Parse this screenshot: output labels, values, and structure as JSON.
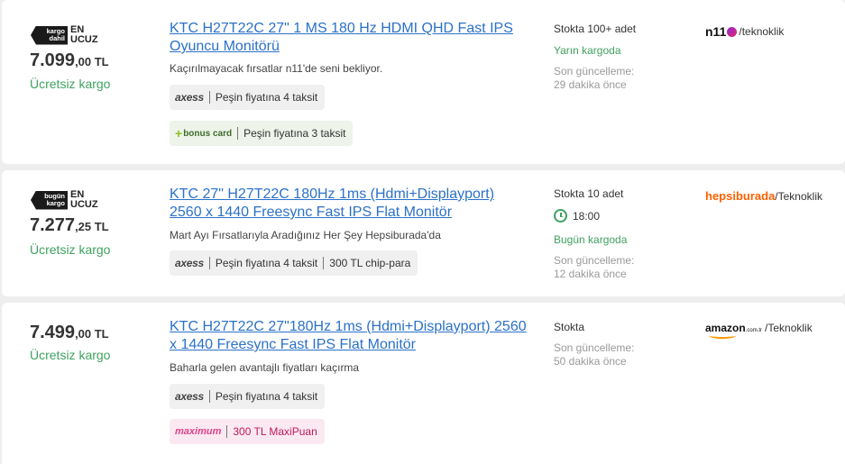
{
  "offers": [
    {
      "badge": {
        "box": "kargo dahil",
        "text_line1": "EN",
        "text_line2": "UCUZ"
      },
      "price_int": "7.099",
      "price_cur": ",00 TL",
      "shipping_note": "Ücretsiz kargo",
      "title": "KTC H27T22C 27\" 1 MS 180 Hz HDMI QHD Fast IPS Oyuncu Monitörü",
      "description": "Kaçırılmayacak fırsatlar n11'de seni bekliyor.",
      "installments": [
        {
          "brand": "axess",
          "label": "Peşin fiyatına 4 taksit"
        },
        {
          "brand": "bonus card",
          "label": "Peşin fiyatına 3 taksit"
        }
      ],
      "stock": "Stokta 100+ adet",
      "delivery": "Yarın kargoda",
      "updated_line1": "Son güncelleme:",
      "updated_line2": "29 dakika önce",
      "seller_brand": "n11",
      "seller_name": "/teknoklik"
    },
    {
      "badge": {
        "box": "bugün kargo",
        "text_line1": "EN",
        "text_line2": "UCUZ"
      },
      "price_int": "7.277",
      "price_cur": ",25 TL",
      "shipping_note": "Ücretsiz kargo",
      "title": "KTC 27\" H27T22C 180Hz 1ms (Hdmi+Displayport) 2560 x 1440 Freesync Fast IPS Flat Monitör",
      "description": "Mart Ayı Fırsatlarıyla Aradığınız Her Şey Hepsiburada'da",
      "installments": [
        {
          "brand": "axess",
          "label": "Peşin fiyatına 4 taksit",
          "extra": "300 TL chip-para"
        }
      ],
      "stock": "Stokta 10 adet",
      "cutoff_time": "18:00",
      "delivery": "Bugün kargoda",
      "updated_line1": "Son güncelleme:",
      "updated_line2": "12 dakika önce",
      "seller_brand": "hepsiburada",
      "seller_name": "/Teknoklik"
    },
    {
      "price_int": "7.499",
      "price_cur": ",00 TL",
      "shipping_note": "Ücretsiz kargo",
      "title": "KTC H27T22C 27\"180Hz 1ms (Hdmi+Displayport) 2560 x 1440 Freesync Fast IPS Flat Monitör",
      "description": "Baharla gelen avantajlı fiyatları kaçırma",
      "installments": [
        {
          "brand": "axess",
          "label": "Peşin fiyatına 4 taksit"
        },
        {
          "brand": "maximum",
          "label": "300 TL MaxiPuan"
        }
      ],
      "stock": "Stokta",
      "updated_line1": "Son güncelleme:",
      "updated_line2": "50 dakika önce",
      "seller_brand": "amazon",
      "seller_brand_suffix": ".com.tr",
      "seller_name": "/Teknoklik"
    }
  ],
  "colors": {
    "link": "#2b71c8",
    "green": "#3fa15f",
    "hepsiburada": "#ff6000",
    "maximum": "#e0408a"
  }
}
